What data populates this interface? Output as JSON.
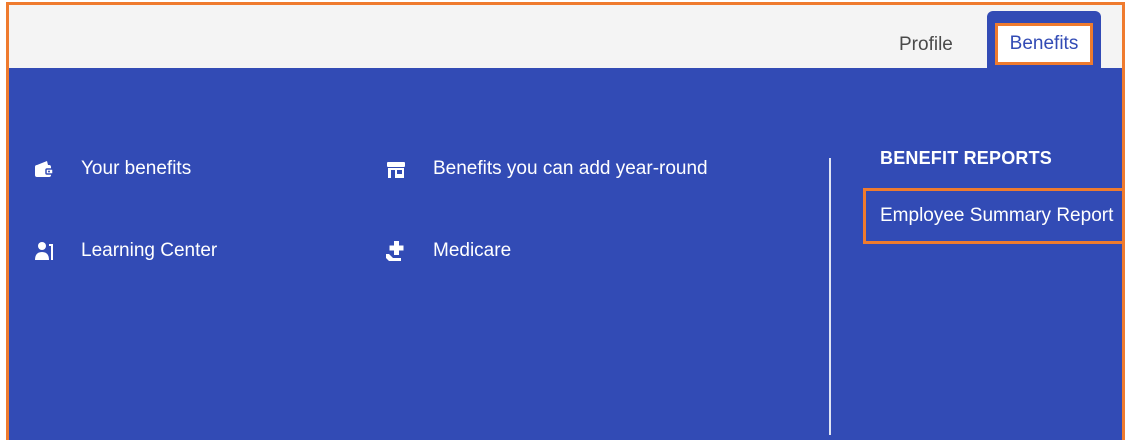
{
  "tabs": {
    "profile_label": "Profile",
    "benefits_label": "Benefits"
  },
  "menu": {
    "items": [
      {
        "label": "Your benefits",
        "icon": "wallet-icon"
      },
      {
        "label": "Benefits you can add year-round",
        "icon": "store-icon"
      },
      {
        "label": "Learning Center",
        "icon": "learning-person-icon"
      },
      {
        "label": "Medicare",
        "icon": "medical-plus-icon"
      }
    ]
  },
  "reports": {
    "heading": "BENEFIT REPORTS",
    "links": [
      {
        "label": "Employee Summary Report"
      }
    ]
  },
  "colors": {
    "panel_blue": "#324bb5",
    "highlight_orange": "#ef7b2e",
    "topbar_gray": "#f4f4f4"
  }
}
